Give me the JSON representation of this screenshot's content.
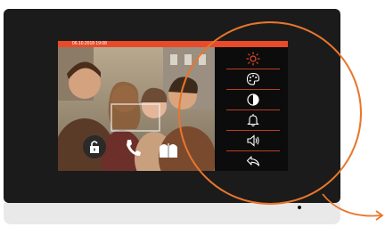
{
  "status": {
    "datetime": "06.10.2018   19:08"
  },
  "menu": {
    "items": [
      {
        "name": "brightness",
        "icon": "sun-icon"
      },
      {
        "name": "color",
        "icon": "palette-icon"
      },
      {
        "name": "contrast",
        "icon": "contrast-icon"
      },
      {
        "name": "ringtone",
        "icon": "bell-icon"
      },
      {
        "name": "volume",
        "icon": "speaker-icon"
      },
      {
        "name": "back",
        "icon": "return-arrow-icon"
      }
    ]
  },
  "colors": {
    "accent": "#e84b2a",
    "active_icon": "#e84b2a",
    "icon": "#ffffff",
    "callout": "#e8762c"
  }
}
